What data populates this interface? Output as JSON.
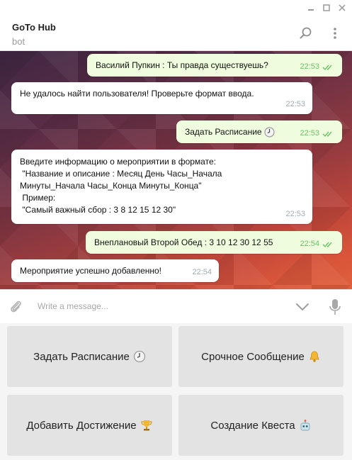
{
  "header": {
    "title": "GoTo Hub",
    "subtitle": "bot"
  },
  "messages": [
    {
      "dir": "out",
      "text": "Василий Пупкин : Ты правда существуешь?",
      "time": "22:53",
      "read": true
    },
    {
      "dir": "in",
      "text": "Не удалось найти пользователя! Проверьте формат ввода.",
      "time": "22:53"
    },
    {
      "dir": "out",
      "text": "Задать Расписание",
      "emoji": "clock-icon",
      "time": "22:53",
      "read": true
    },
    {
      "dir": "in",
      "lines": [
        "Введите информацию о мероприятии в формате:",
        " \"Название и описание : Месяц День Часы_Начала",
        "Минуты_Начала Часы_Конца Минуты_Конца\"",
        " Пример:",
        " \"Самый важный сбор : 3 8 12 15 12 30\""
      ],
      "time": "22:53"
    },
    {
      "dir": "out",
      "text": "Внеплановый Второй Обед : 3 10 12 30 12 55",
      "time": "22:54",
      "read": true
    },
    {
      "dir": "in",
      "text": "Мероприятие успешно добавленно!",
      "time": "22:54"
    }
  ],
  "composer": {
    "placeholder": "Write a message..."
  },
  "keyboard": {
    "buttons": [
      {
        "label": "Задать Расписание",
        "icon": "clock-icon"
      },
      {
        "label": "Срочное Сообщение",
        "icon": "bell-icon"
      },
      {
        "label": "Добавить Достижение",
        "icon": "trophy-icon"
      },
      {
        "label": "Создание Квеста",
        "icon": "robot-icon"
      }
    ]
  },
  "colors": {
    "out_bubble": "#effdde",
    "in_bubble": "#ffffff",
    "read_check": "#6cc264",
    "key_bg": "#e3e3e3"
  }
}
